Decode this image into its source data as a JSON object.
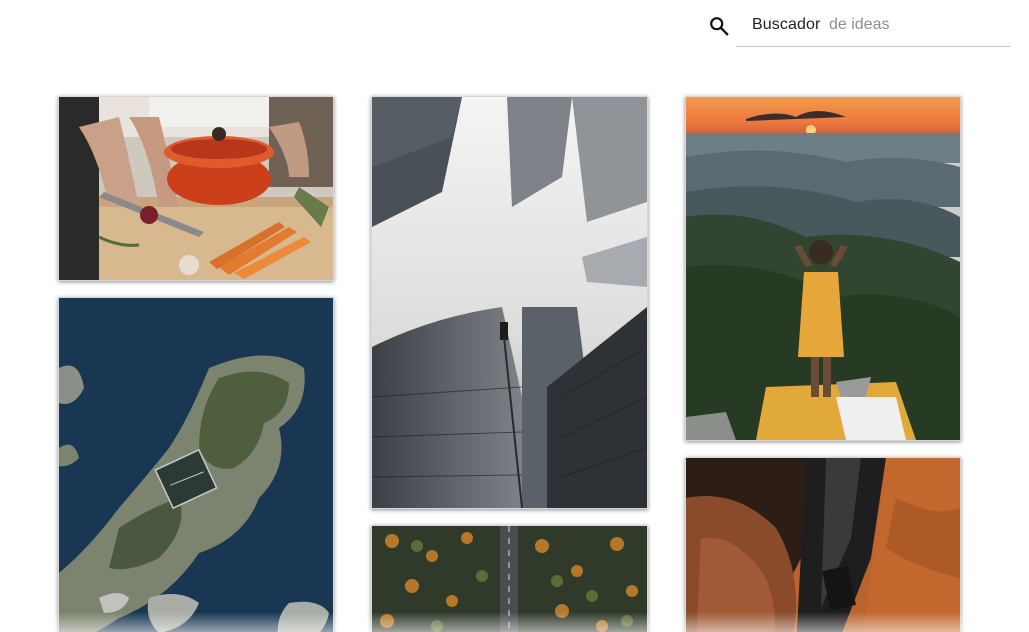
{
  "search": {
    "label": "Buscador",
    "placeholder": "de ideas",
    "icon": "search-icon"
  },
  "gallery": {
    "photos": [
      {
        "name": "cooking-photo",
        "subject": "hands cooking with red pot and carrots"
      },
      {
        "name": "island-aerial-photo",
        "subject": "aerial view of island"
      },
      {
        "name": "skyscrapers-photo",
        "subject": "looking up at skyscrapers in fog"
      },
      {
        "name": "forest-road-photo",
        "subject": "aerial road through autumn forest"
      },
      {
        "name": "sunset-mountain-photo",
        "subject": "woman standing on mountain at sunset"
      },
      {
        "name": "skin-closeup-photo",
        "subject": "close-up of skin and fabric"
      }
    ]
  },
  "colors": {
    "search_border": "#c9c9c9",
    "placeholder": "#8f8f8f",
    "text": "#222222"
  }
}
